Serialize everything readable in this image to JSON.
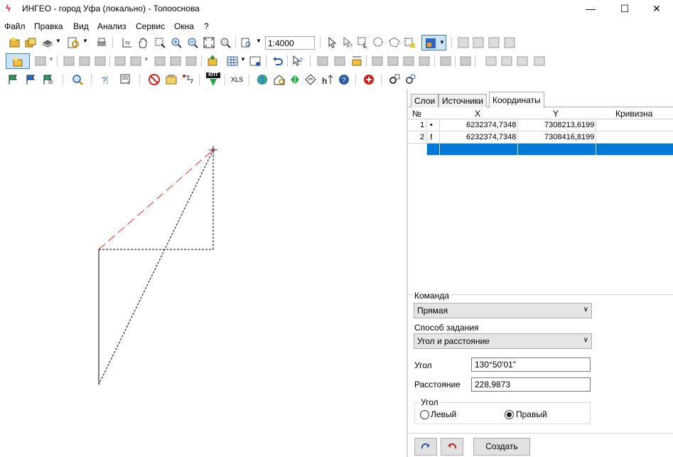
{
  "window": {
    "title": "ИНГЕО - город Уфа (локально) - Топооснова",
    "min_glyph": "—",
    "max_glyph": "☐",
    "close_glyph": "✕"
  },
  "menu": [
    "Файл",
    "Правка",
    "Вид",
    "Анализ",
    "Сервис",
    "Окна",
    "?"
  ],
  "toolbar": {
    "scale": "1:4000",
    "xls_label": "XLS",
    "knp_label": "КПТ"
  },
  "tabs": [
    {
      "label": "Слои",
      "active": false
    },
    {
      "label": "Источники",
      "active": false
    },
    {
      "label": "Координаты",
      "active": true
    }
  ],
  "grid": {
    "headers": {
      "num": "№",
      "x": "X",
      "y": "Y",
      "curv": "Кривизна"
    },
    "rows": [
      {
        "num": "1",
        "mark": "•",
        "x": "6232374,7348",
        "y": "7308213,6199",
        "curv": ""
      },
      {
        "num": "2",
        "mark": "!",
        "x": "6232374,7348",
        "y": "7308416,8199",
        "curv": ""
      }
    ]
  },
  "form": {
    "command_label": "Команда",
    "command_value": "Прямая",
    "method_label": "Способ задания",
    "method_value": "Угол и расстояние",
    "angle_label": "Угол",
    "angle_value": "130°50'01\"",
    "distance_label": "Расстояние",
    "distance_value": "228,9873",
    "angle_group_label": "Угол",
    "left_label": "Левый",
    "right_label": "Правый",
    "left_selected": false,
    "right_selected": true
  },
  "buttons": {
    "create_label": "Создать"
  }
}
